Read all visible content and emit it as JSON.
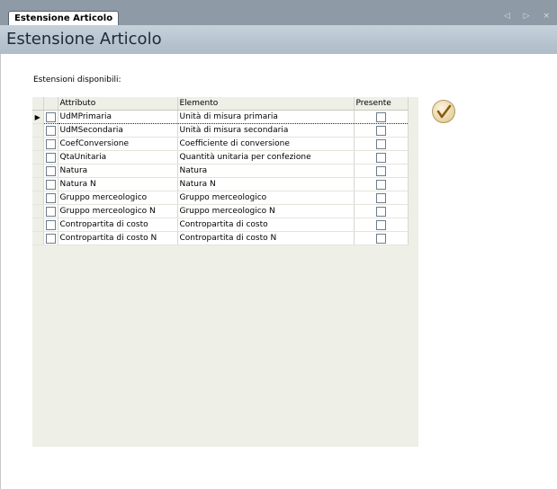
{
  "tab": {
    "label": "Estensione Articolo"
  },
  "nav": {
    "arrows": "◁ ▷ ×"
  },
  "header": {
    "title": "Estensione Articolo"
  },
  "main": {
    "label": "Estensioni disponibili:",
    "columns": {
      "attributo": "Attributo",
      "elemento": "Elemento",
      "presente": "Presente"
    },
    "rows": [
      {
        "attributo": "UdMPrimaria",
        "elemento": "Unità di misura primaria"
      },
      {
        "attributo": "UdMSecondaria",
        "elemento": "Unità di misura secondaria"
      },
      {
        "attributo": "CoefConversione",
        "elemento": "Coefficiente di conversione"
      },
      {
        "attributo": "QtaUnitaria",
        "elemento": "Quantità unitaria per confezione"
      },
      {
        "attributo": "Natura",
        "elemento": "Natura"
      },
      {
        "attributo": "Natura N",
        "elemento": "Natura N"
      },
      {
        "attributo": "Gruppo merceologico",
        "elemento": "Gruppo merceologico"
      },
      {
        "attributo": "Gruppo merceologico N",
        "elemento": "Gruppo merceologico N"
      },
      {
        "attributo": "Contropartita di costo",
        "elemento": "Contropartita di costo"
      },
      {
        "attributo": "Contropartita di costo N",
        "elemento": "Contropartita di costo N"
      }
    ]
  },
  "colors": {
    "tabstrip": "#8e9aa5",
    "titlebar": "#b7c4cf",
    "grid": "#eeefe6",
    "check": "#8a5a10"
  },
  "icons": {
    "confirm": "checkmark-icon",
    "row_indicator": "current-row-arrow-icon"
  }
}
